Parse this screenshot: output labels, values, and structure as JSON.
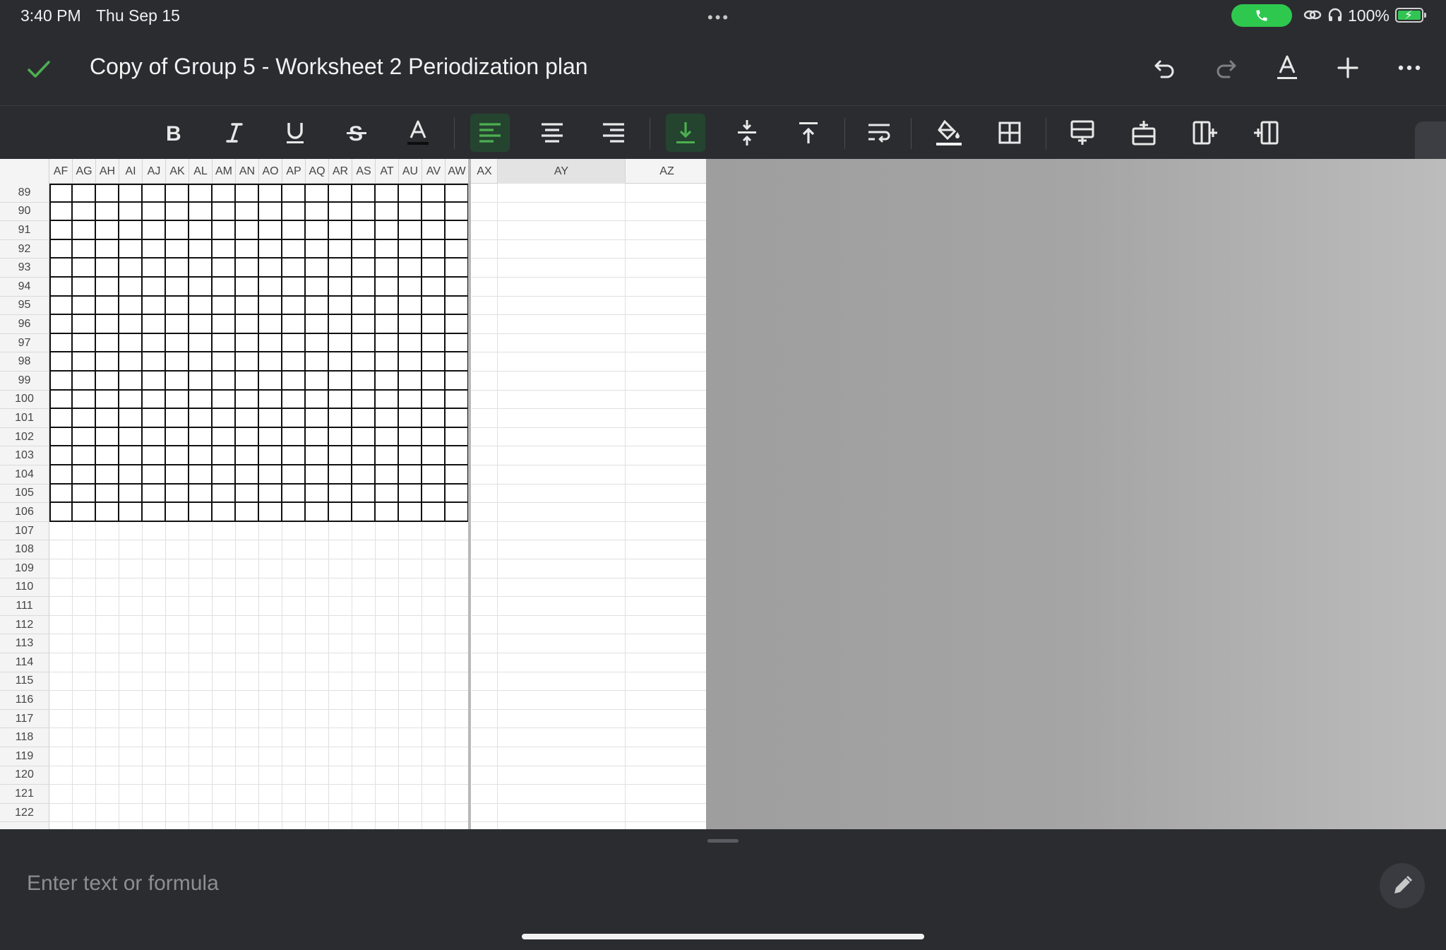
{
  "status_bar": {
    "time": "3:40 PM",
    "date": "Thu Sep 15",
    "dots": "•••",
    "battery": "100%",
    "colors": {
      "call_pill": "#2fc84f",
      "battery_fill": "#31c453"
    }
  },
  "document": {
    "title": "Copy of Group 5 - Worksheet 2 Periodization plan"
  },
  "title_actions": [
    "check-icon",
    "undo-icon",
    "redo-icon",
    "text-format-icon",
    "add-icon",
    "more-icon"
  ],
  "toolbar": {
    "tools": [
      "bold",
      "italic",
      "underline",
      "strikethrough",
      "text-color",
      "align-left",
      "align-center",
      "align-right",
      "valign-bottom",
      "valign-middle",
      "valign-top",
      "wrap-text",
      "fill-color",
      "borders",
      "insert-row-above",
      "insert-row-below",
      "insert-column-left",
      "insert-column-right"
    ],
    "active": [
      "align-left",
      "valign-bottom"
    ],
    "accent_color": "#4caf50"
  },
  "sheet": {
    "columns": [
      "AF",
      "AG",
      "AH",
      "AI",
      "AJ",
      "AK",
      "AL",
      "AM",
      "AN",
      "AO",
      "AP",
      "AQ",
      "AR",
      "AS",
      "AT",
      "AU",
      "AV",
      "AW",
      "AX",
      "AY",
      "AZ"
    ],
    "row_start": 89,
    "row_end": 122,
    "bordered_range": {
      "first_column": "AF",
      "last_column": "AW",
      "first_row": 89,
      "last_row": 106
    },
    "frozen_after_column": "AW"
  },
  "formula_bar": {
    "placeholder": "Enter text or formula",
    "value": ""
  }
}
